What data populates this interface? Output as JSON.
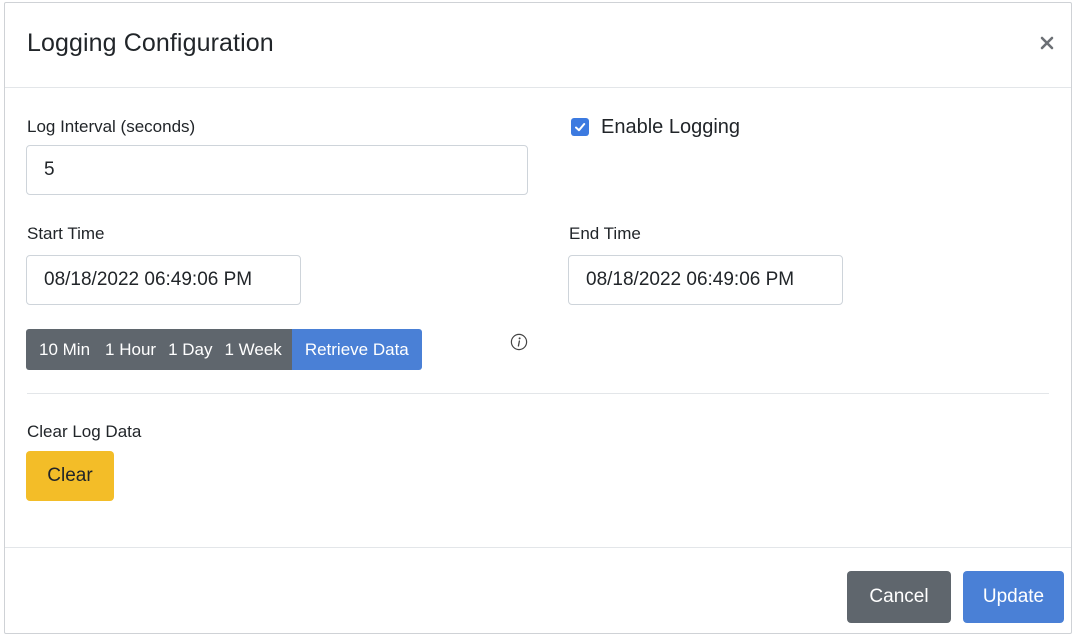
{
  "modal": {
    "title": "Logging Configuration",
    "close_icon": "close-icon"
  },
  "log_interval": {
    "label": "Log Interval (seconds)",
    "value": "5"
  },
  "enable_logging": {
    "label": "Enable Logging",
    "checked": true
  },
  "start_time": {
    "label": "Start Time",
    "value": "08/18/2022 06:49:06 PM"
  },
  "end_time": {
    "label": "End Time",
    "value": "08/18/2022 06:49:06 PM"
  },
  "range_buttons": [
    "10 Min",
    "1 Hour",
    "1 Day",
    "1 Week"
  ],
  "retrieve_button": "Retrieve Data",
  "info_icon": "info-icon",
  "clear_section": {
    "label": "Clear Log Data",
    "button": "Clear"
  },
  "footer": {
    "cancel": "Cancel",
    "update": "Update"
  },
  "colors": {
    "primary": "#4a80d6",
    "secondary": "#5f666d",
    "warning": "#f3bd28"
  }
}
